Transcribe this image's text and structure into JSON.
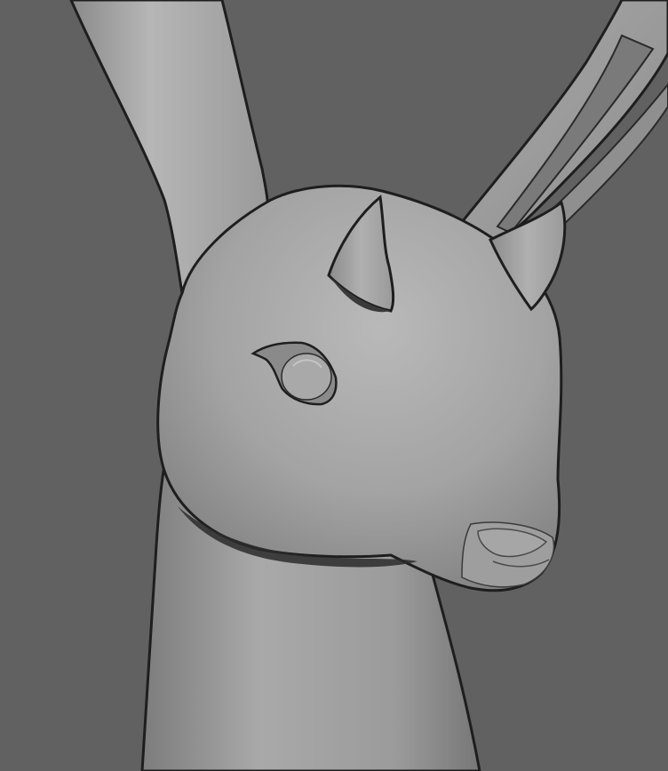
{
  "viewport": {
    "background_color": "#616161",
    "subject": "rabbit-head-model",
    "shading": "smooth-gray",
    "colors": {
      "model_light": "#b4b4b4",
      "model_mid": "#9a9a9a",
      "model_dark": "#6e6e6e",
      "outline": "#1e1e1e"
    }
  }
}
